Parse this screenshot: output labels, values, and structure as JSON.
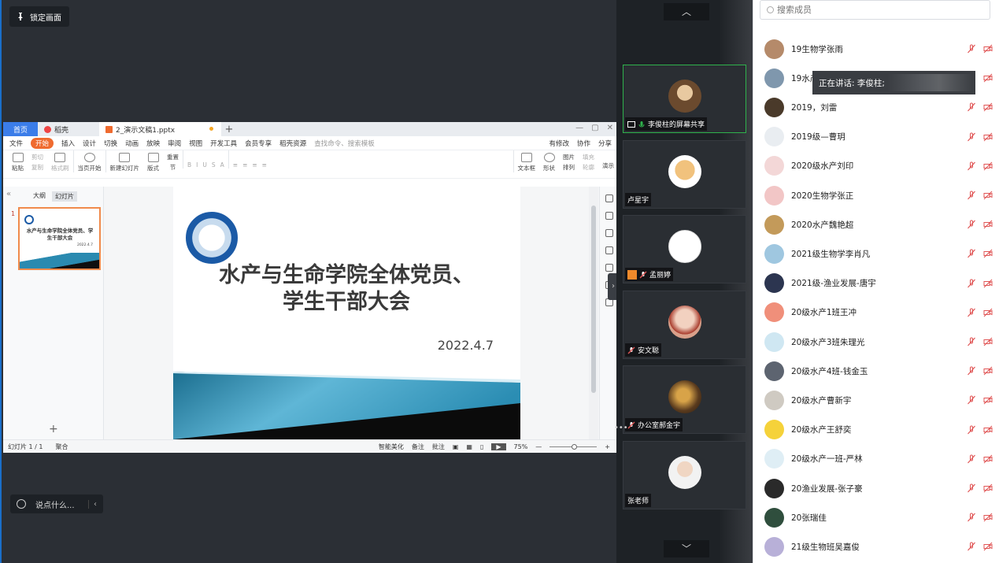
{
  "stage": {
    "lock_label": "锁定画面",
    "chat_placeholder": "说点什么..."
  },
  "wps": {
    "tabs": {
      "home": "首页",
      "doc": "稻壳",
      "file": "2_演示文稿1.pptx"
    },
    "menu": [
      "文件",
      "开始",
      "插入",
      "设计",
      "切换",
      "动画",
      "放映",
      "审阅",
      "视图",
      "开发工具",
      "会员专享",
      "稻壳资源"
    ],
    "menu_search": "查找命令、搜索模板",
    "menu_right": [
      "有修改",
      "协作",
      "分享"
    ],
    "ribbon": [
      "粘贴",
      "剪切",
      "复制",
      "格式刷",
      "当页开始",
      "新建幻灯片",
      "版式",
      "节",
      "重置",
      "文本框",
      "形状",
      "图片",
      "排列",
      "填充",
      "轮廓",
      "演示"
    ],
    "panel_tabs": {
      "outline": "大纲",
      "slides": "幻灯片"
    },
    "thumb": {
      "num": "1",
      "title": "水产与生命学院全体党员、学生干部大会",
      "date": "2022.4.7"
    },
    "slide": {
      "title_line1": "水产与生命学院全体党员、",
      "title_line2": "学生干部大会",
      "date": "2022.4.7"
    },
    "status": {
      "slide_count": "幻灯片 1 / 1",
      "theme": "聚合",
      "beautify": "智能美化",
      "notes": "备注",
      "comment": "批注",
      "zoom": "75%"
    }
  },
  "videos": [
    {
      "name": "李俊柱的屏幕共享",
      "active": true,
      "avatar_color": "#6b4a2e"
    },
    {
      "name": "卢星宇",
      "active": false,
      "avatar_color": "#f1c27d"
    },
    {
      "name": "孟丽婷",
      "active": false,
      "avatar_color": "#ffffff"
    },
    {
      "name": "安文聪",
      "active": false,
      "avatar_color": "#d9a08a"
    },
    {
      "name": "办公室郝金宇",
      "active": false,
      "avatar_color": "#5a3b1e"
    },
    {
      "name": "张老师",
      "active": false,
      "avatar_color": "#f2f2f2"
    }
  ],
  "members": {
    "search_placeholder": "搜索成员",
    "speaking": "正在讲话: 李俊柱;",
    "list": [
      {
        "name": "19生物学张雨",
        "color": "#b58a6a"
      },
      {
        "name": "19水产",
        "color": "#7f97ad"
      },
      {
        "name": "2019，刘雷",
        "color": "#4a3a2a"
      },
      {
        "name": "2019级—曹玥",
        "color": "#e9edf1"
      },
      {
        "name": "2020级水产刘印",
        "color": "#f3d7d7"
      },
      {
        "name": "2020生物学张正",
        "color": "#f2c6c6"
      },
      {
        "name": "2020水产魏艳超",
        "color": "#c39a5a"
      },
      {
        "name": "2021级生物学李肖凡",
        "color": "#9fc7e0"
      },
      {
        "name": "2021级-渔业发展-唐宇",
        "color": "#2c3550"
      },
      {
        "name": "20级水产1班王冲",
        "color": "#f08f7a"
      },
      {
        "name": "20级水产3班朱理光",
        "color": "#cfe7f2"
      },
      {
        "name": "20级水产4班-钱金玉",
        "color": "#5d6470"
      },
      {
        "name": "20级水产曹新宇",
        "color": "#cfcac2"
      },
      {
        "name": "20级水产王舒奕",
        "color": "#f5d23a"
      },
      {
        "name": "20级水产一班-严林",
        "color": "#dfeef5"
      },
      {
        "name": "20渔业发展-张子豪",
        "color": "#2a2a2a"
      },
      {
        "name": "20张瑞佳",
        "color": "#2f4e3d"
      },
      {
        "name": "21级生物班吴嘉俊",
        "color": "#b8b0d8"
      }
    ]
  },
  "colors": {
    "accent": "#1a6ec9",
    "mute": "#e05555",
    "active_border": "#2fb24c",
    "wps_orange": "#ef6b2f"
  }
}
